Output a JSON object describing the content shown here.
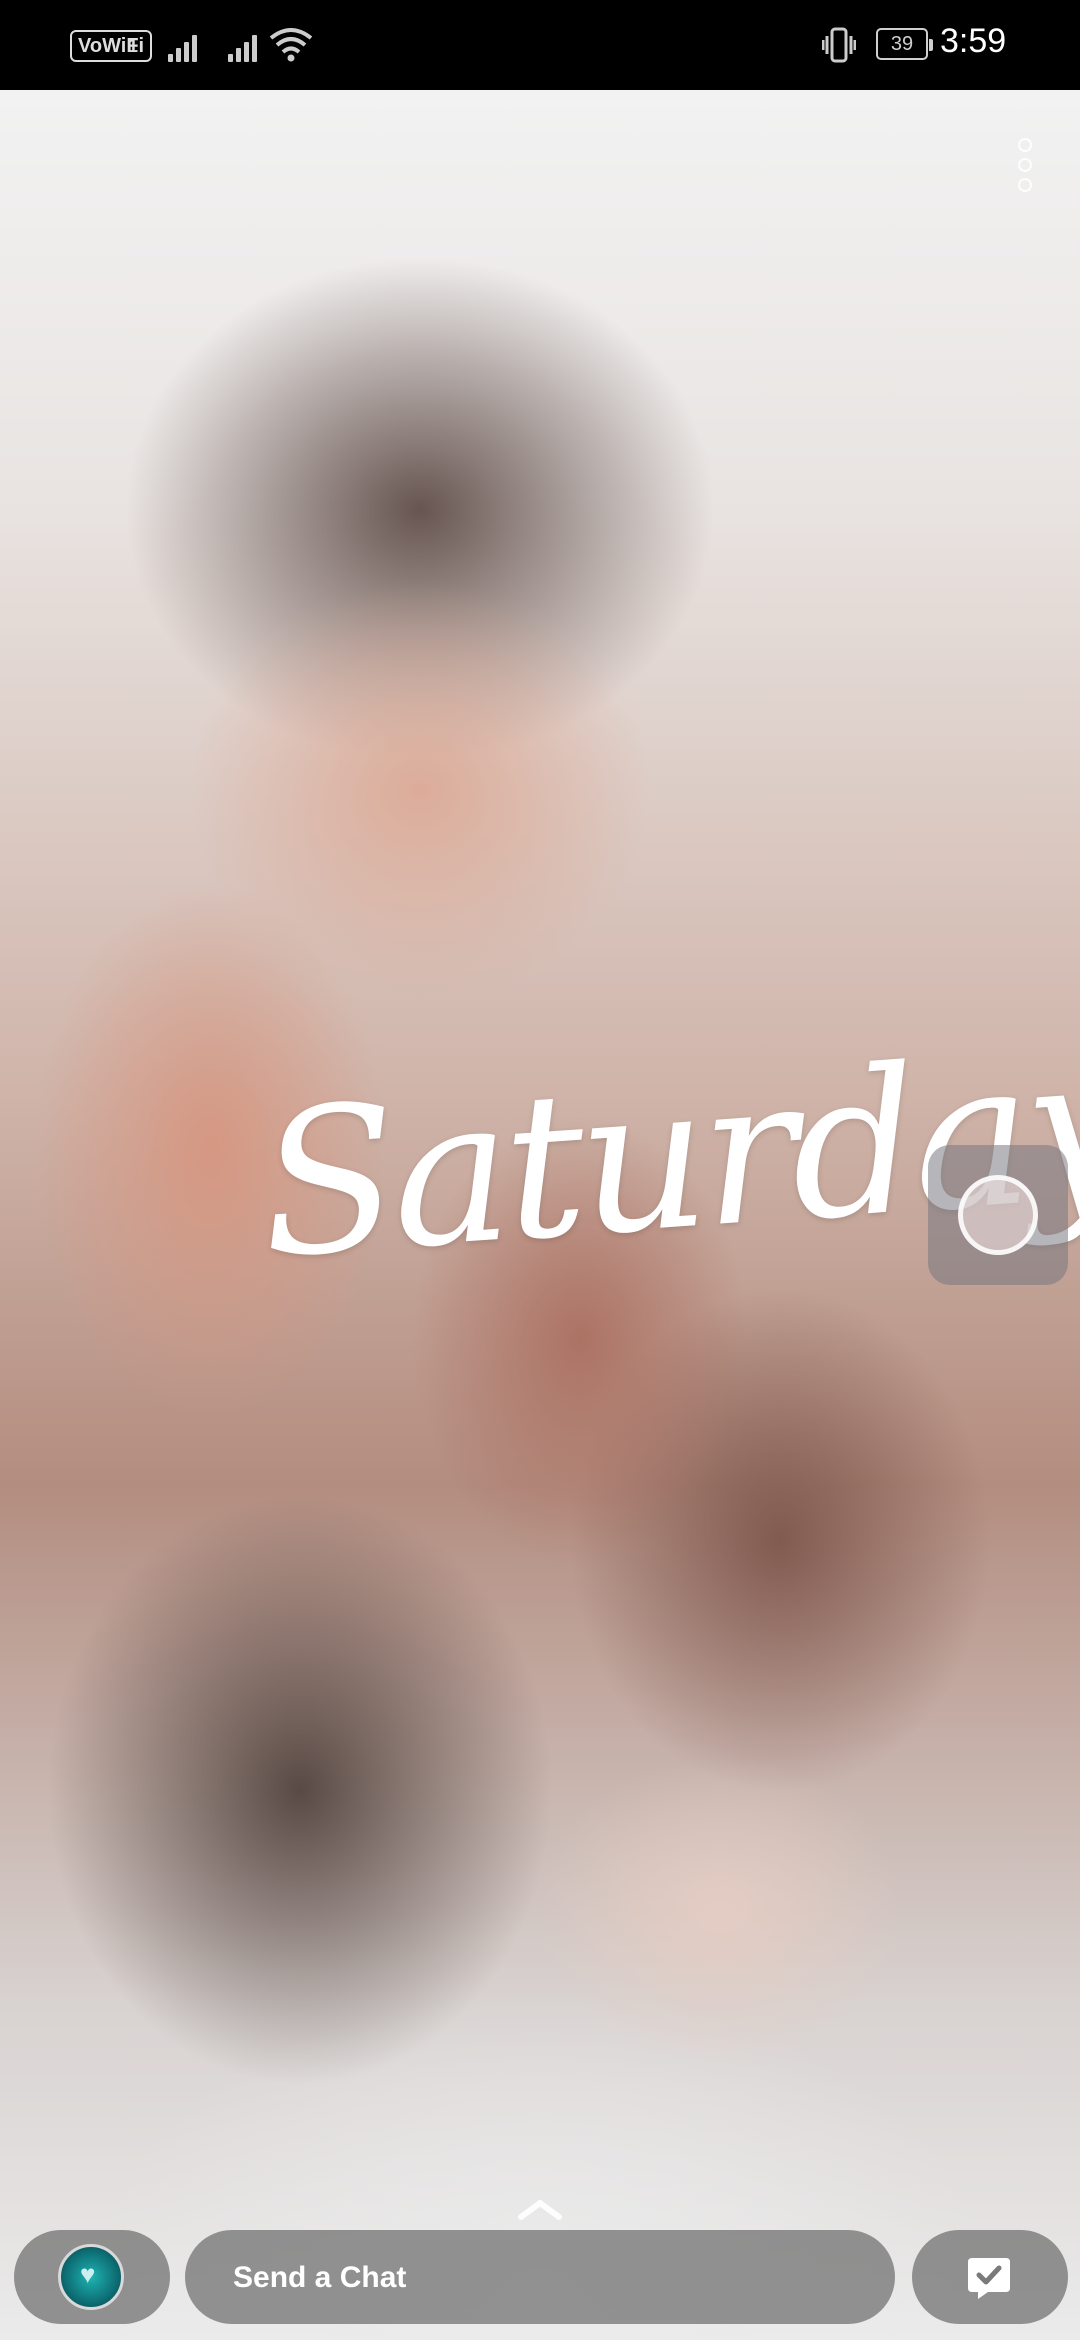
{
  "status_bar": {
    "vowifi_label": "VoWiFi",
    "sim_number": "1",
    "battery_level": "39",
    "time": "3:59"
  },
  "story": {
    "overlay_text": "Saturday"
  },
  "bottom_bar": {
    "chat_placeholder": "Send a Chat"
  },
  "icons": {
    "more": "more-vertical-icon",
    "shutter": "floating-camera-shutter-icon",
    "swipe": "chevron-up-icon",
    "reply": "chat-reply-icon",
    "avatar": "bitmoji-avatar"
  }
}
